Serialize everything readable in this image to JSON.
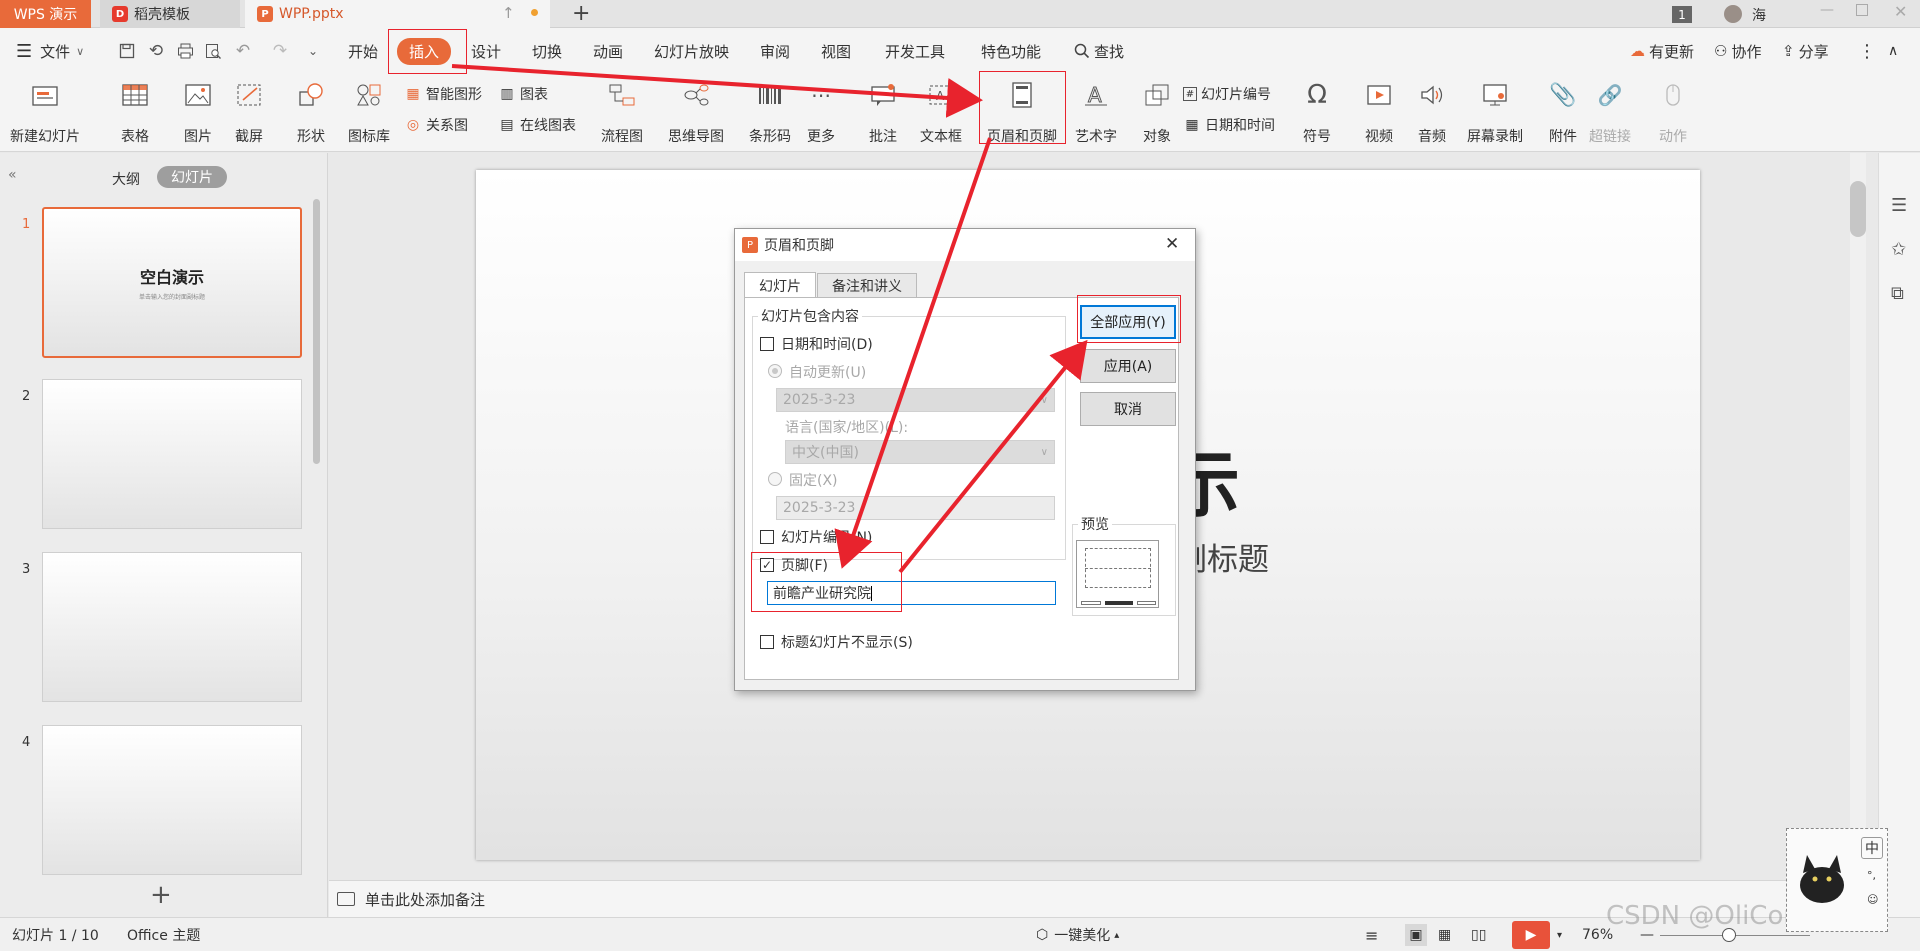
{
  "tabs": {
    "app": "WPS 演示",
    "template": "稻壳模板",
    "doc": "WPP.pptx",
    "new_tab": "+",
    "page_badge": "1",
    "user": "海"
  },
  "menu": {
    "file": "文件",
    "items": [
      "开始",
      "插入",
      "设计",
      "切换",
      "动画",
      "幻灯片放映",
      "审阅",
      "视图",
      "开发工具",
      "特色功能"
    ],
    "search": "查找",
    "right": [
      "有更新",
      "协作",
      "分享"
    ]
  },
  "ribbon": {
    "new_slide": "新建幻灯片",
    "table": "表格",
    "picture": "图片",
    "screenshot": "截屏",
    "shape": "形状",
    "icon_lib": "图标库",
    "smart_art": "智能图形",
    "chart": "图表",
    "relation": "关系图",
    "online_chart": "在线图表",
    "flowchart": "流程图",
    "mindmap": "思维导图",
    "barcode": "条形码",
    "more": "更多",
    "comment": "批注",
    "textbox": "文本框",
    "header_footer": "页眉和页脚",
    "wordart": "艺术字",
    "object": "对象",
    "slide_number": "幻灯片编号",
    "datetime": "日期和时间",
    "symbol": "符号",
    "video": "视频",
    "audio": "音频",
    "screen_record": "屏幕录制",
    "attachment": "附件",
    "hyperlink": "超链接",
    "action": "动作"
  },
  "left_panel": {
    "outline_tab": "大纲",
    "slides_tab": "幻灯片",
    "thumb1_title": "空白演示",
    "thumb1_sub": "单击输入您的封面副标题",
    "numbers": [
      "1",
      "2",
      "3",
      "4"
    ],
    "add": "+"
  },
  "slide": {
    "title_fragment": "示",
    "subtitle_fragment": "副标题"
  },
  "notes": {
    "placeholder": "单击此处添加备注"
  },
  "dialog": {
    "title": "页眉和页脚",
    "tab_slide": "幻灯片",
    "tab_notes": "备注和讲义",
    "group_label": "幻灯片包含内容",
    "datetime": "日期和时间(D)",
    "auto_update": "自动更新(U)",
    "date_auto": "2025-3-23",
    "language_label": "语言(国家/地区)(L):",
    "language": "中文(中国)",
    "fixed": "固定(X)",
    "date_fixed": "2025-3-23",
    "slide_number": "幻灯片编号(N)",
    "footer": "页脚(F)",
    "footer_value": "前瞻产业研究院",
    "hide_title": "标题幻灯片不显示(S)",
    "apply_all": "全部应用(Y)",
    "apply": "应用(A)",
    "cancel": "取消",
    "preview": "预览"
  },
  "status": {
    "slide_count": "幻灯片 1 / 10",
    "theme": "Office 主题",
    "beautify": "一键美化",
    "zoom": "76%",
    "watermark": "CSDN @OliConvert",
    "ime": "中"
  },
  "colors": {
    "accent": "#e86a3a",
    "annotation_red": "#e8232d",
    "primary_button_border": "#0078d7"
  }
}
